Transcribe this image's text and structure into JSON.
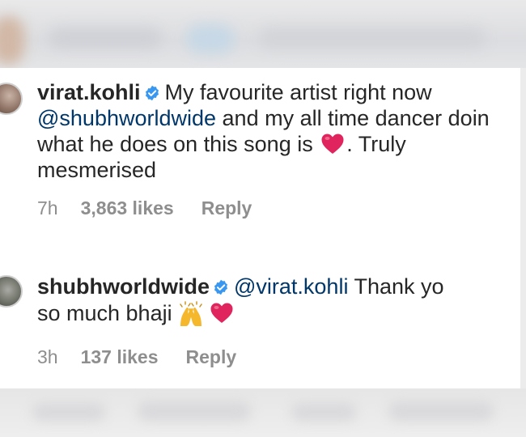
{
  "comments": [
    {
      "username": "virat.kohli",
      "lines": [
        {
          "text": "My favourite artist right now"
        },
        {
          "mention": "@shubhworldwide",
          "text": " and my all time dancer doin"
        },
        {
          "text": "what he does on this song is",
          "after": ". Truly"
        },
        {
          "text": "mesmerised"
        }
      ],
      "time": "7h",
      "likes": "3,863 likes",
      "reply": "Reply"
    },
    {
      "username": "shubhworldwide",
      "mention": "@virat.kohli",
      "line1_text": " Thank yo",
      "line2_text": "so much bhaji",
      "time": "3h",
      "likes": "137 likes",
      "reply": "Reply"
    }
  ],
  "icons": {
    "verified": "verified-badge-icon",
    "heart": "red-heart-emoji",
    "hands": "raising-hands-emoji"
  },
  "colors": {
    "text": "#262626",
    "mention": "#00376b",
    "meta": "#8e8e8e",
    "verified": "#3897f0",
    "heart": "#e0245e"
  }
}
